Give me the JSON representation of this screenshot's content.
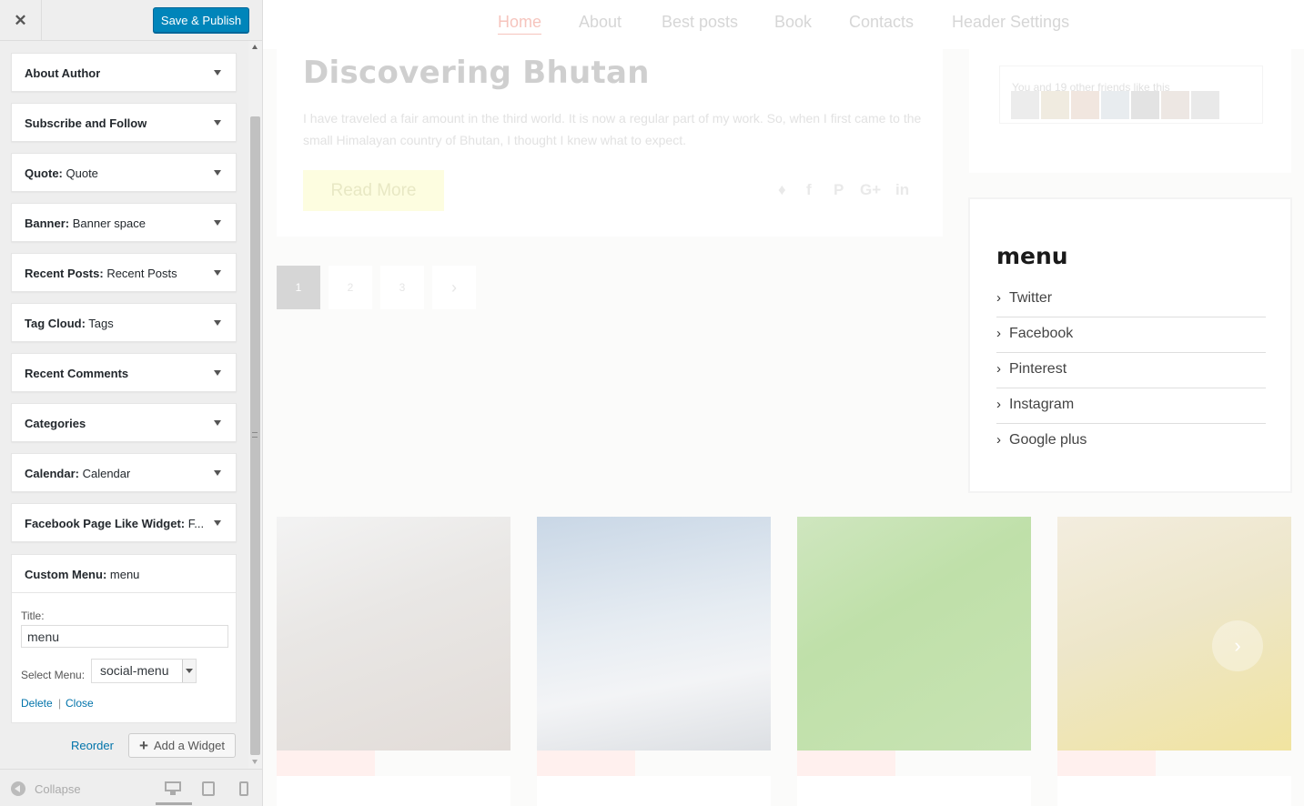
{
  "sidebar": {
    "close_icon": "close-icon",
    "save_label": "Save & Publish",
    "widgets": [
      {
        "name": "About Author",
        "sub": ""
      },
      {
        "name": "Subscribe and Follow",
        "sub": ""
      },
      {
        "name": "Quote:",
        "sub": " Quote"
      },
      {
        "name": "Banner:",
        "sub": " Banner space"
      },
      {
        "name": "Recent Posts:",
        "sub": " Recent Posts"
      },
      {
        "name": "Tag Cloud:",
        "sub": " Tags"
      },
      {
        "name": "Recent Comments",
        "sub": ""
      },
      {
        "name": "Categories",
        "sub": ""
      },
      {
        "name": "Calendar:",
        "sub": " Calendar"
      },
      {
        "name": "Facebook Page Like Widget:",
        "sub": " F..."
      }
    ],
    "open_widget": {
      "name": "Custom Menu:",
      "sub": " menu",
      "title_label": "Title:",
      "title_value": "menu",
      "select_label": "Select Menu:",
      "select_value": "social-menu",
      "delete_label": "Delete",
      "separator": "|",
      "close_label": "Close"
    },
    "reorder_label": "Reorder",
    "add_widget_label": "Add a Widget",
    "collapse_label": "Collapse"
  },
  "preview": {
    "nav": [
      "Home",
      "About",
      "Best posts",
      "Book",
      "Contacts",
      "Header Settings"
    ],
    "post": {
      "title": "Discovering Bhutan",
      "excerpt": "I have traveled a fair amount in the third world. It is now a regular part of my work. So, when I first came to the small Himalayan country of Bhutan, I thought I knew what to expect.",
      "read_more": "Read More",
      "share_icons": [
        "twitter-icon",
        "facebook-icon",
        "pinterest-icon",
        "google-plus-icon",
        "linkedin-icon"
      ]
    },
    "pagination": [
      "1",
      "2",
      "3",
      "›"
    ],
    "facebook_text": "You and 19 other friends like this",
    "menu_widget": {
      "title": "menu",
      "items": [
        "Twitter",
        "Facebook",
        "Pinterest",
        "Instagram",
        "Google plus"
      ]
    }
  },
  "colors": {
    "accent": "#0085ba",
    "link": "#0073aa",
    "nav_active": "#f6c4bd"
  }
}
